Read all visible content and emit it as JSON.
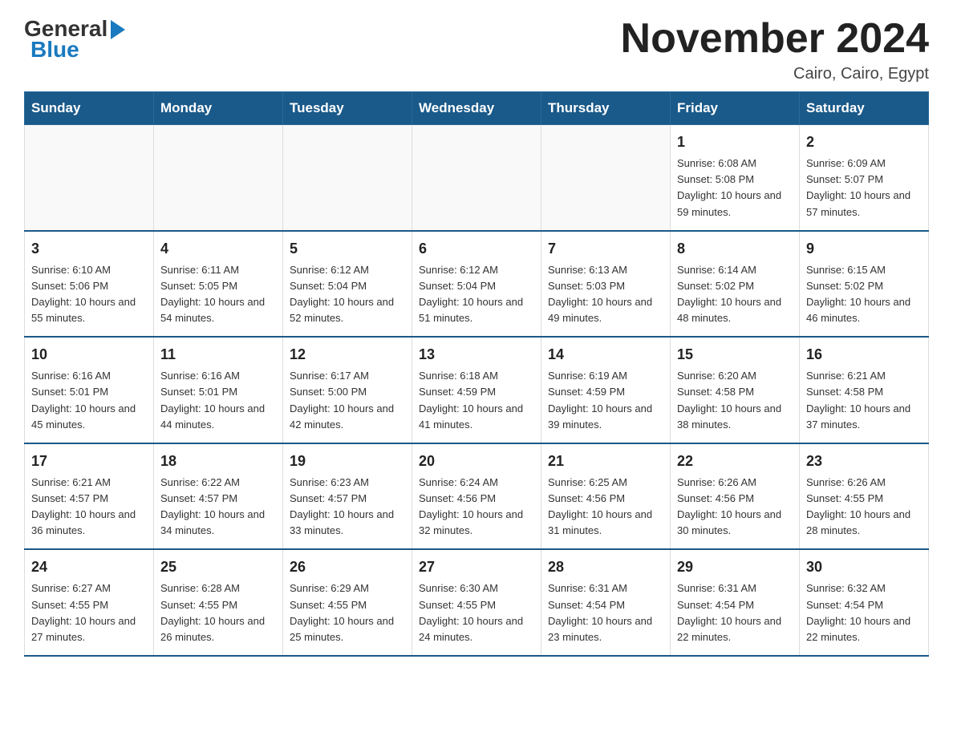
{
  "logo": {
    "general": "General",
    "blue": "Blue"
  },
  "header": {
    "month_title": "November 2024",
    "location": "Cairo, Cairo, Egypt"
  },
  "weekdays": [
    "Sunday",
    "Monday",
    "Tuesday",
    "Wednesday",
    "Thursday",
    "Friday",
    "Saturday"
  ],
  "weeks": [
    [
      {
        "day": "",
        "info": ""
      },
      {
        "day": "",
        "info": ""
      },
      {
        "day": "",
        "info": ""
      },
      {
        "day": "",
        "info": ""
      },
      {
        "day": "",
        "info": ""
      },
      {
        "day": "1",
        "info": "Sunrise: 6:08 AM\nSunset: 5:08 PM\nDaylight: 10 hours and 59 minutes."
      },
      {
        "day": "2",
        "info": "Sunrise: 6:09 AM\nSunset: 5:07 PM\nDaylight: 10 hours and 57 minutes."
      }
    ],
    [
      {
        "day": "3",
        "info": "Sunrise: 6:10 AM\nSunset: 5:06 PM\nDaylight: 10 hours and 55 minutes."
      },
      {
        "day": "4",
        "info": "Sunrise: 6:11 AM\nSunset: 5:05 PM\nDaylight: 10 hours and 54 minutes."
      },
      {
        "day": "5",
        "info": "Sunrise: 6:12 AM\nSunset: 5:04 PM\nDaylight: 10 hours and 52 minutes."
      },
      {
        "day": "6",
        "info": "Sunrise: 6:12 AM\nSunset: 5:04 PM\nDaylight: 10 hours and 51 minutes."
      },
      {
        "day": "7",
        "info": "Sunrise: 6:13 AM\nSunset: 5:03 PM\nDaylight: 10 hours and 49 minutes."
      },
      {
        "day": "8",
        "info": "Sunrise: 6:14 AM\nSunset: 5:02 PM\nDaylight: 10 hours and 48 minutes."
      },
      {
        "day": "9",
        "info": "Sunrise: 6:15 AM\nSunset: 5:02 PM\nDaylight: 10 hours and 46 minutes."
      }
    ],
    [
      {
        "day": "10",
        "info": "Sunrise: 6:16 AM\nSunset: 5:01 PM\nDaylight: 10 hours and 45 minutes."
      },
      {
        "day": "11",
        "info": "Sunrise: 6:16 AM\nSunset: 5:01 PM\nDaylight: 10 hours and 44 minutes."
      },
      {
        "day": "12",
        "info": "Sunrise: 6:17 AM\nSunset: 5:00 PM\nDaylight: 10 hours and 42 minutes."
      },
      {
        "day": "13",
        "info": "Sunrise: 6:18 AM\nSunset: 4:59 PM\nDaylight: 10 hours and 41 minutes."
      },
      {
        "day": "14",
        "info": "Sunrise: 6:19 AM\nSunset: 4:59 PM\nDaylight: 10 hours and 39 minutes."
      },
      {
        "day": "15",
        "info": "Sunrise: 6:20 AM\nSunset: 4:58 PM\nDaylight: 10 hours and 38 minutes."
      },
      {
        "day": "16",
        "info": "Sunrise: 6:21 AM\nSunset: 4:58 PM\nDaylight: 10 hours and 37 minutes."
      }
    ],
    [
      {
        "day": "17",
        "info": "Sunrise: 6:21 AM\nSunset: 4:57 PM\nDaylight: 10 hours and 36 minutes."
      },
      {
        "day": "18",
        "info": "Sunrise: 6:22 AM\nSunset: 4:57 PM\nDaylight: 10 hours and 34 minutes."
      },
      {
        "day": "19",
        "info": "Sunrise: 6:23 AM\nSunset: 4:57 PM\nDaylight: 10 hours and 33 minutes."
      },
      {
        "day": "20",
        "info": "Sunrise: 6:24 AM\nSunset: 4:56 PM\nDaylight: 10 hours and 32 minutes."
      },
      {
        "day": "21",
        "info": "Sunrise: 6:25 AM\nSunset: 4:56 PM\nDaylight: 10 hours and 31 minutes."
      },
      {
        "day": "22",
        "info": "Sunrise: 6:26 AM\nSunset: 4:56 PM\nDaylight: 10 hours and 30 minutes."
      },
      {
        "day": "23",
        "info": "Sunrise: 6:26 AM\nSunset: 4:55 PM\nDaylight: 10 hours and 28 minutes."
      }
    ],
    [
      {
        "day": "24",
        "info": "Sunrise: 6:27 AM\nSunset: 4:55 PM\nDaylight: 10 hours and 27 minutes."
      },
      {
        "day": "25",
        "info": "Sunrise: 6:28 AM\nSunset: 4:55 PM\nDaylight: 10 hours and 26 minutes."
      },
      {
        "day": "26",
        "info": "Sunrise: 6:29 AM\nSunset: 4:55 PM\nDaylight: 10 hours and 25 minutes."
      },
      {
        "day": "27",
        "info": "Sunrise: 6:30 AM\nSunset: 4:55 PM\nDaylight: 10 hours and 24 minutes."
      },
      {
        "day": "28",
        "info": "Sunrise: 6:31 AM\nSunset: 4:54 PM\nDaylight: 10 hours and 23 minutes."
      },
      {
        "day": "29",
        "info": "Sunrise: 6:31 AM\nSunset: 4:54 PM\nDaylight: 10 hours and 22 minutes."
      },
      {
        "day": "30",
        "info": "Sunrise: 6:32 AM\nSunset: 4:54 PM\nDaylight: 10 hours and 22 minutes."
      }
    ]
  ]
}
